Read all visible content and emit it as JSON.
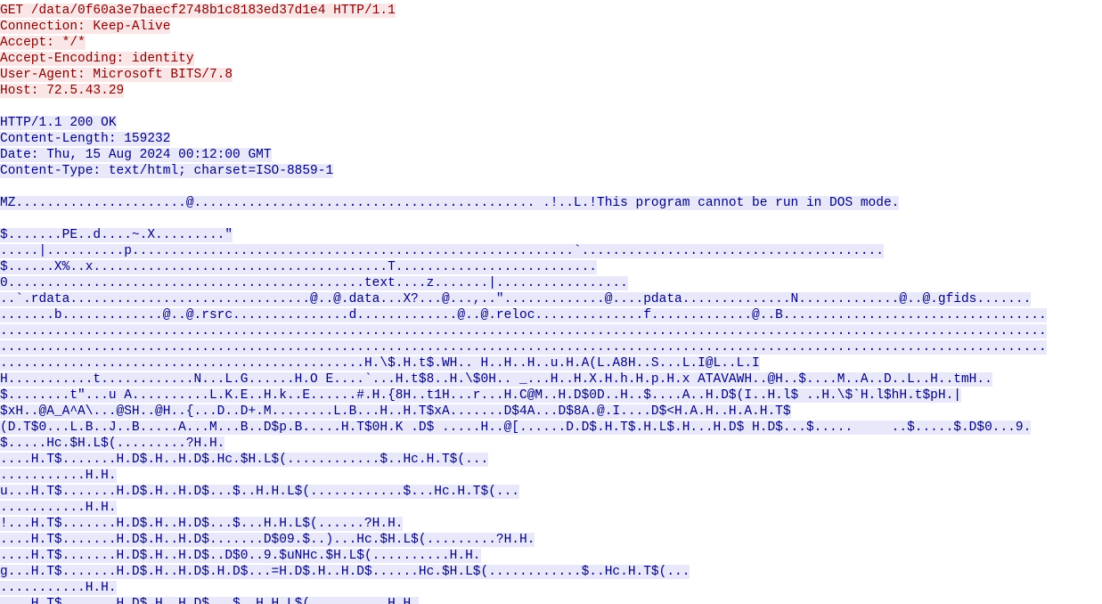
{
  "colors": {
    "request_text": "#850000",
    "request_background": "#fae6e6",
    "response_text": "#000080",
    "response_background": "#e8e8fa",
    "page_background": "#ffffff"
  },
  "request": {
    "request_line": "GET /data/0f60a3e7baecf2748b1c8183ed37d1e4 HTTP/1.1",
    "headers": [
      "Connection: Keep-Alive",
      "Accept: */*",
      "Accept-Encoding: identity",
      "User-Agent: Microsoft BITS/7.8",
      "Host: 72.5.43.29"
    ]
  },
  "response": {
    "status_line": "HTTP/1.1 200 OK",
    "headers": [
      "Content-Length: 159232",
      "Date: Thu, 15 Aug 2024 00:12:00 GMT",
      "Content-Type: text/html; charset=ISO-8859-1"
    ],
    "body_lines": [
      "MZ......................@............................................ .!..L.!This program cannot be run in DOS mode.",
      "",
      "$.......PE..d....~.X.........\"",
      ".....|..........p.........................................................`.......................................",
      "$......X%..x......................................T..........................",
      "0..............................................text....z.......|.................",
      "..`.rdata...............................@..@.data...X?...@...,..\".............@....pdata..............N.............@..@.gfids.......",
      ".......b.............@..@.rsrc...............d.............@..@.reloc..............f.............@..B..................................",
      ".......................................................................................................................................",
      ".......................................................................................................................................",
      "...............................................H.\\$.H.t$.WH.. H..H..H..u.H.A(L.A8H..S...L.I@L..L.I",
      "H...........t............N...L.G......H.O E....`...H.t$8..H.\\$0H.. _...H..H.X.H.h.H.p.H.x ATAVAWH..@H..$....M..A..D..L..H..tmH..",
      "$........t\"...u A..........L.K.E..H.k..E......#.H.{8H..t1H...r...H.C@M..H.D$0D..H..$....A..H.D$(I..H.l$ ..H.\\$`H.l$hH.t$pH.|",
      "$xH..@A_A^A\\...@SH..@H..{...D..D+.M........L.B...H..H.T$xA.......D$4A...D$8A.@.I....D$<H.A.H..H.A.H.T$",
      "(D.T$0...L.B..J..B.....A...M...B..D$p.B.....H.T$0H.K .D$ .....H..@[......D.D$.H.T$.H.L$.H...H.D$ H.D$...$.....     ..$.....$.D$0...9.",
      "$.....Hc.$H.L$(.........?H.H.",
      "....H.T$.......H.D$.H..H.D$.Hc.$H.L$(............$..Hc.H.T$(...",
      "...........H.H.",
      "u...H.T$.......H.D$.H..H.D$...$..H.H.L$(............$...Hc.H.T$(...",
      "...........H.H.",
      "!...H.T$.......H.D$.H..H.D$...$...H.H.L$(......?H.H.",
      "....H.T$.......H.D$.H..H.D$.......D$09.$..)...Hc.$H.L$(.........?H.H.",
      "....H.T$.......H.D$.H..H.D$..D$0..9.$uNHc.$H.L$(..........H.H.",
      "g...H.T$.......H.D$.H..H.D$.H.D$...=H.D$.H..H.D$......Hc.$H.L$(............$..Hc.H.T$(...",
      "...........H.H.",
      "....H.T$.......H.D$.H..H.D$...$..H.H.L$(..........H.H."
    ]
  }
}
